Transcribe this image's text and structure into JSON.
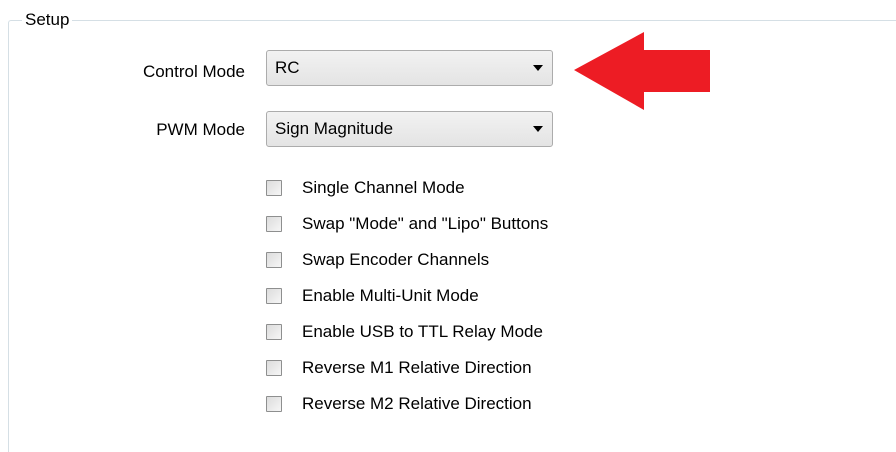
{
  "group": {
    "title": "Setup"
  },
  "control_mode": {
    "label": "Control Mode",
    "value": "RC"
  },
  "pwm_mode": {
    "label": "PWM Mode",
    "value": "Sign Magnitude"
  },
  "checkboxes": [
    {
      "label": "Single Channel Mode",
      "checked": false
    },
    {
      "label": "Swap \"Mode\" and \"Lipo\" Buttons",
      "checked": false
    },
    {
      "label": "Swap Encoder Channels",
      "checked": false
    },
    {
      "label": "Enable Multi-Unit Mode",
      "checked": false
    },
    {
      "label": "Enable USB to TTL Relay Mode",
      "checked": false
    },
    {
      "label": "Reverse M1 Relative Direction",
      "checked": false
    },
    {
      "label": "Reverse M2 Relative Direction",
      "checked": false
    }
  ],
  "colors": {
    "annotation_arrow": "#ed1c24",
    "groupbox_border": "#d5dfe5"
  },
  "icons": {
    "annotation": "red-arrow-icon",
    "dropdown": "chevron-down-icon"
  }
}
